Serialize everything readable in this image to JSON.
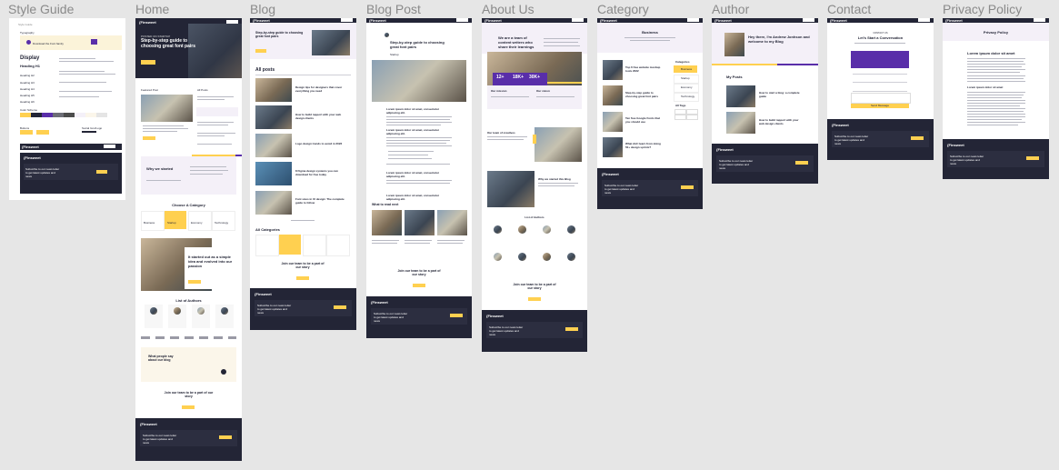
{
  "frames": [
    {
      "id": "style-guide",
      "title": "Style Guide"
    },
    {
      "id": "home",
      "title": "Home"
    },
    {
      "id": "blog",
      "title": "Blog"
    },
    {
      "id": "blog-post",
      "title": "Blog Post"
    },
    {
      "id": "about",
      "title": "About Us"
    },
    {
      "id": "category",
      "title": "Category"
    },
    {
      "id": "author",
      "title": "Author"
    },
    {
      "id": "contact",
      "title": "Contact"
    },
    {
      "id": "privacy",
      "title": "Privacy Policy"
    }
  ],
  "brand": {
    "logo": "{Finsweet",
    "accent": "#ffd050",
    "dark": "#232536",
    "purple": "#592ea9",
    "lavender": "#f4f0f8"
  },
  "style_guide": {
    "label": "Style Guide",
    "typography": "Typography",
    "download": "Download the Font family",
    "display": "Display",
    "heading1": "Heading H1",
    "heading2": "Heading H2",
    "heading3": "Heading H3",
    "heading4": "Heading H4",
    "heading5": "Heading H5",
    "heading6": "Heading H6",
    "color_scheme": "Color Scheme",
    "buttons": "Buttons",
    "social": "Social Icon/Logo"
  },
  "home": {
    "hero_kicker": "POSTED ON STARTUP",
    "hero_title": "Step-by-step guide to choosing great font pairs",
    "hero_btn": "Read More",
    "featured": "Featured Post",
    "all_posts": "All Posts",
    "about_title": "Why we started",
    "category_title": "Choose A Category",
    "cats": [
      "Business",
      "Startup",
      "Economy",
      "Technology"
    ],
    "story_title": "It started out as a simple idea and evolved into our passion",
    "authors_title": "List of Authors",
    "testimonial_title": "What people say about our blog",
    "join_title": "Join our team to be a part of our story",
    "join_btn": "Join Now"
  },
  "blog": {
    "hero_title": "Step-by-step guide to choosing great font pairs",
    "all_posts": "All posts",
    "posts": [
      "Design tips for designers that cover everything you need",
      "How to build rapport with your web design clients",
      "Logo design trends to avoid in 2022",
      "8 Figma design systems you can download for free today",
      "Font sizes in UI design: The complete guide to follow"
    ],
    "all_categories": "All Categories",
    "join_title": "Join our team to be a part of our story"
  },
  "blog_post": {
    "title": "Step-by-step guide to choosing great font pairs",
    "tag": "Startup",
    "h1": "Lorem ipsum dolor sit amet, consectetur adipiscing elit.",
    "read_next": "What to read next",
    "join_title": "Join our team to be a part of our story"
  },
  "about": {
    "hero_title": "We are a team of content writers who share their learnings",
    "stats": [
      "12+",
      "18K+",
      "30K+"
    ],
    "mission": "Our mission",
    "vision": "Our vision",
    "team_title": "Our team of creatives",
    "why_title": "Why we started this Blog",
    "authors_title": "List of Authors",
    "join_title": "Join our team to be a part of our story"
  },
  "category": {
    "title": "Business",
    "categories_label": "Categories",
    "cats": [
      "Business",
      "Startup",
      "Economy",
      "Technology"
    ],
    "tags_label": "All Tags",
    "posts": [
      "Top 6 free website mockup tools 2022",
      "Step-by-step guide to choosing great font pairs",
      "Ten free Google Fonts that you should use",
      "What did I learn from doing 50+ design sprints?"
    ]
  },
  "author": {
    "title": "Hey there, I'm Andrew Jonhson and welcome to my Blog",
    "my_posts": "My Posts",
    "posts": [
      "How to start a blog: a complete guide",
      "How to build rapport with your web design clients"
    ]
  },
  "contact": {
    "kicker": "CONTACT US",
    "title": "Let's Start a Conversation",
    "send": "Send Message"
  },
  "privacy": {
    "title": "Privacy Policy",
    "heading": "Lorem ipsum dolor sit amet"
  },
  "footer": {
    "subscribe": "Subscribe to our news letter to get latest updates and news",
    "btn": "Subscribe"
  }
}
